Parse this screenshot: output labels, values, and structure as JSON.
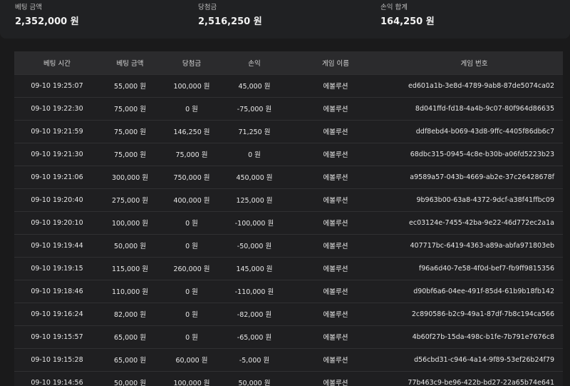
{
  "summary": [
    {
      "label": "베팅 금액",
      "value": "2,352,000 원"
    },
    {
      "label": "당첨금",
      "value": "2,516,250 원"
    },
    {
      "label": "손익 합계",
      "value": "164,250 원"
    }
  ],
  "table": {
    "headers": [
      "베팅 시간",
      "베팅 금액",
      "당첨금",
      "손익",
      "게임 이름",
      "게임 번호"
    ],
    "rows": [
      [
        "09-10 19:25:07",
        "55,000 원",
        "100,000 원",
        "45,000 원",
        "에볼루션",
        "ed601a1b-3e8d-4789-9ab8-87de5074ca02"
      ],
      [
        "09-10 19:22:30",
        "75,000 원",
        "0 원",
        "-75,000 원",
        "에볼루션",
        "8d041ffd-fd18-4a4b-9c07-80f964d86635"
      ],
      [
        "09-10 19:21:59",
        "75,000 원",
        "146,250 원",
        "71,250 원",
        "에볼루션",
        "ddf8ebd4-b069-43d8-9ffc-4405f86db6c7"
      ],
      [
        "09-10 19:21:30",
        "75,000 원",
        "75,000 원",
        "0 원",
        "에볼루션",
        "68dbc315-0945-4c8e-b30b-a06fd5223b23"
      ],
      [
        "09-10 19:21:06",
        "300,000 원",
        "750,000 원",
        "450,000 원",
        "에볼루션",
        "a9589a57-043b-4669-ab2e-37c26428678f"
      ],
      [
        "09-10 19:20:40",
        "275,000 원",
        "400,000 원",
        "125,000 원",
        "에볼루션",
        "9b963b00-63a8-4372-9dcf-a38f41ffbc09"
      ],
      [
        "09-10 19:20:10",
        "100,000 원",
        "0 원",
        "-100,000 원",
        "에볼루션",
        "ec03124e-7455-42ba-9e22-46d772ec2a1a"
      ],
      [
        "09-10 19:19:44",
        "50,000 원",
        "0 원",
        "-50,000 원",
        "에볼루션",
        "407717bc-6419-4363-a89a-abfa971803eb"
      ],
      [
        "09-10 19:19:15",
        "115,000 원",
        "260,000 원",
        "145,000 원",
        "에볼루션",
        "f96a6d40-7e58-4f0d-bef7-fb9ff9815356"
      ],
      [
        "09-10 19:18:46",
        "110,000 원",
        "0 원",
        "-110,000 원",
        "에볼루션",
        "d90bf6a6-04ee-491f-85d4-61b9b18fb142"
      ],
      [
        "09-10 19:16:24",
        "82,000 원",
        "0 원",
        "-82,000 원",
        "에볼루션",
        "2c890586-b2c9-49a1-87df-7b8c194ca566"
      ],
      [
        "09-10 19:15:57",
        "65,000 원",
        "0 원",
        "-65,000 원",
        "에볼루션",
        "4b60f27b-15da-498c-b1fe-7b791e7676c8"
      ],
      [
        "09-10 19:15:28",
        "65,000 원",
        "60,000 원",
        "-5,000 원",
        "에볼루션",
        "d56cbd31-c946-4a14-9f89-53ef26b24f79"
      ],
      [
        "09-10 19:14:56",
        "50,000 원",
        "100,000 원",
        "50,000 원",
        "에볼루션",
        "77b463c9-be96-422b-bd27-22a65b74e641"
      ]
    ]
  }
}
